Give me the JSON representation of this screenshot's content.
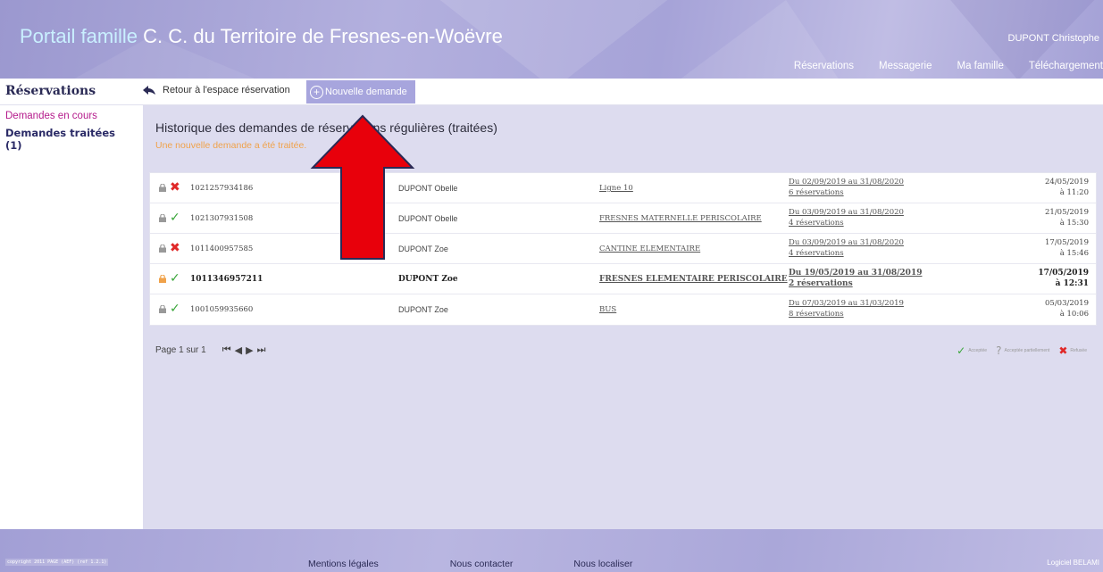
{
  "header": {
    "title_part1": "Portail famille",
    "title_part2": " C. C. du Territoire de Fresnes-en-Woëvre",
    "user": "DUPONT Christophe",
    "nav": [
      "Réservations",
      "Messagerie",
      "Ma famille",
      "Téléchargement"
    ]
  },
  "toolbar": {
    "section_title": "Réservations",
    "back_label": "Retour à l'espace réservation",
    "new_request_label": "Nouvelle demande"
  },
  "sidebar": {
    "items": [
      {
        "label": "Demandes en cours"
      },
      {
        "label": "Demandes traitées (1)"
      }
    ]
  },
  "main": {
    "title": "Historique des demandes de réservations régulières (traitées)",
    "message": "Une nouvelle demande a été traitée."
  },
  "table": {
    "rows": [
      {
        "status": "✖",
        "status_kind": "refused",
        "number": "1021257934186",
        "person": "DUPONT Obelle",
        "service": "Ligne 10",
        "period": "Du 02/09/2019 au 31/08/2020",
        "count": "6 réservations",
        "date": "24/05/2019",
        "time": "à 11:20",
        "bold": false
      },
      {
        "status": "✓",
        "status_kind": "accepted",
        "number": "1021307931508",
        "person": "DUPONT Obelle",
        "service": "FRESNES MATERNELLE PERISCOLAIRE",
        "period": "Du 03/09/2019 au 31/08/2020",
        "count": "4 réservations",
        "date": "21/05/2019",
        "time": "à 15:30",
        "bold": false
      },
      {
        "status": "✖",
        "status_kind": "refused",
        "number": "1011400957585",
        "person": "DUPONT Zoe",
        "service": "CANTINE ELEMENTAIRE",
        "period": "Du 03/09/2019 au 31/08/2020",
        "count": "4 réservations",
        "date": "17/05/2019",
        "time": "à 15:46",
        "bold": false
      },
      {
        "status": "✓",
        "status_kind": "accepted",
        "number": "1011346957211",
        "person": "DUPONT Zoe",
        "service": "FRESNES ELEMENTAIRE PERISCOLAIRE",
        "period": "Du 19/05/2019 au 31/08/2019",
        "count": "2 réservations",
        "date": "17/05/2019",
        "time": "à 12:31",
        "bold": true
      },
      {
        "status": "✓",
        "status_kind": "accepted",
        "number": "1001059935660",
        "person": "DUPONT Zoe",
        "service": "BUS",
        "period": "Du 07/03/2019 au 31/03/2019",
        "count": "8 réservations",
        "date": "05/03/2019",
        "time": "à 10:06",
        "bold": false
      }
    ]
  },
  "pager": {
    "label": "Page 1 sur 1",
    "first": "⏮",
    "prev": "◀",
    "next": "▶",
    "last": "⏭"
  },
  "legend": {
    "accepted": "Acceptée",
    "partial": "Acceptée partiellement",
    "refused": "Refusée"
  },
  "footer": {
    "links": [
      "Mentions légales",
      "Nous contacter",
      "Nous localiser"
    ],
    "copyright": "copyright 2011 PAGE (AEF) (ref 1.2.1)",
    "logo": "Logiciel BELAMI"
  },
  "colors": {
    "accent": "#a7a5dd",
    "panel_bg": "#dddcef",
    "accepted": "#3aa63a",
    "refused": "#e02828",
    "notice": "#f0a24a",
    "annotation_arrow": "#e8000b"
  }
}
